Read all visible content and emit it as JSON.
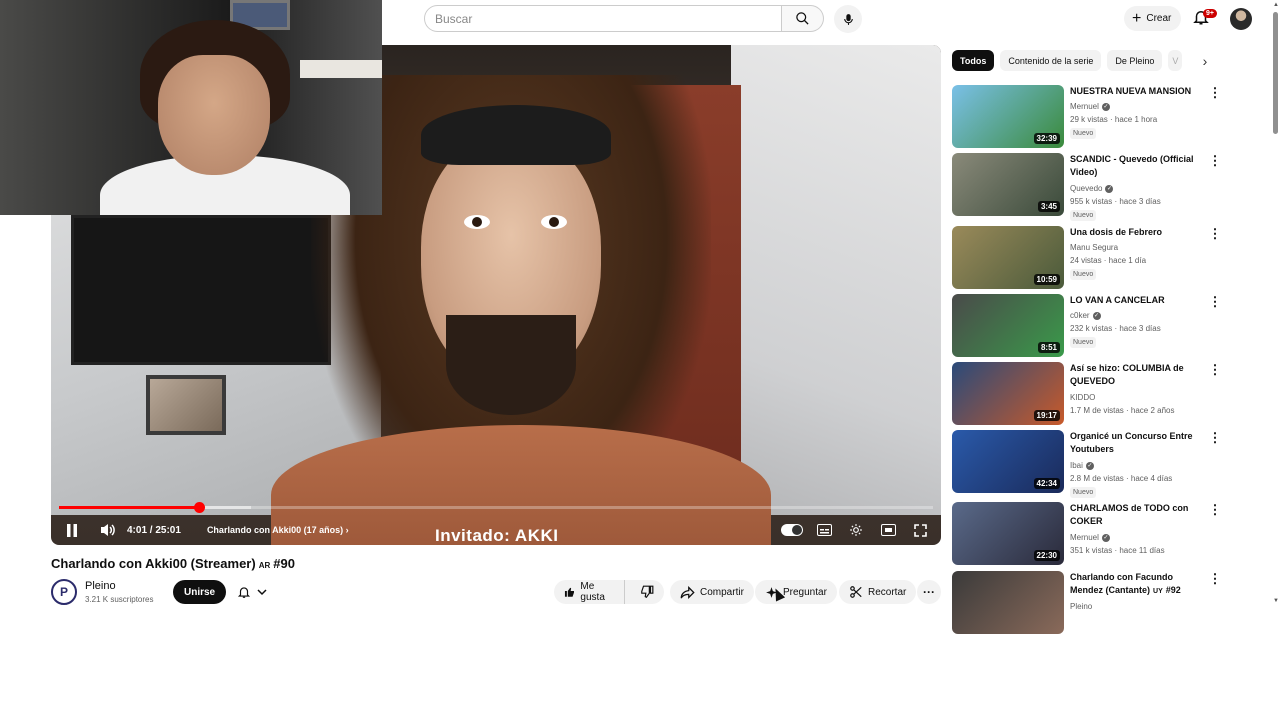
{
  "search": {
    "placeholder": "Buscar"
  },
  "header": {
    "create_label": "Crear",
    "notifications_badge": "9+"
  },
  "player": {
    "time": "4:01 / 25:01",
    "chapter": "Charlando con Akki00 (17 años)",
    "caption": "Invitado: AKKI",
    "progress_played": 0.16,
    "progress_loaded": 0.22
  },
  "video": {
    "title": "Charlando con Akki00 (Streamer)",
    "flag": "AR",
    "episode": "#90",
    "channel": "Pleino",
    "subscribers": "3.21 K suscriptores",
    "join_label": "Unirse",
    "like_label": "Me gusta",
    "share_label": "Compartir",
    "ask_label": "Preguntar",
    "clip_label": "Recortar"
  },
  "chips": [
    "Todos",
    "Contenido de la serie",
    "De Pleino",
    "V"
  ],
  "recommendations": [
    {
      "title": "NUESTRA NUEVA MANSION",
      "channel": "Mernuel",
      "verified": true,
      "meta": "29 k vistas · hace 1 hora",
      "badge": "Nuevo",
      "duration": "32:39",
      "colors": [
        "#7ac0e8",
        "#3a8a3a"
      ]
    },
    {
      "title": "SCANDIC - Quevedo (Official Video)",
      "channel": "Quevedo",
      "verified": true,
      "meta": "955 k vistas · hace 3 días",
      "badge": "Nuevo",
      "duration": "3:45",
      "colors": [
        "#8a8a7a",
        "#3a4a3a"
      ]
    },
    {
      "title": "Una dosis de Febrero",
      "channel": "Manu Segura",
      "verified": false,
      "meta": "24 vistas · hace 1 día",
      "badge": "Nuevo",
      "duration": "10:59",
      "colors": [
        "#9a8a5a",
        "#4a5a3a"
      ]
    },
    {
      "title": "LO VAN A CANCELAR",
      "channel": "c0ker",
      "verified": true,
      "meta": "232 k vistas · hace 3 días",
      "badge": "Nuevo",
      "duration": "8:51",
      "colors": [
        "#4a4a4a",
        "#3a9a4a"
      ]
    },
    {
      "title": "Así se hizo: COLUMBIA de QUEVEDO",
      "channel": "KIDDO",
      "verified": false,
      "meta": "1.7 M de vistas · hace 2 años",
      "badge": "",
      "duration": "19:17",
      "colors": [
        "#2a4a7a",
        "#c85a2a"
      ]
    },
    {
      "title": "Organicé un Concurso Entre Youtubers",
      "channel": "Ibai",
      "verified": true,
      "meta": "2.8 M de vistas · hace 4 días",
      "badge": "Nuevo",
      "duration": "42:34",
      "colors": [
        "#2a5aaa",
        "#1a2a5a"
      ]
    },
    {
      "title": "CHARLAMOS de TODO con COKER",
      "channel": "Mernuel",
      "verified": true,
      "meta": "351 k vistas · hace 11 días",
      "badge": "",
      "duration": "22:30",
      "colors": [
        "#5a6a8a",
        "#2a2a3a"
      ]
    },
    {
      "title": "Charlando con Facundo Mendez (Cantante)",
      "title_flag": "UY",
      "title_suffix": "#92",
      "channel": "Pleino",
      "verified": false,
      "meta": "",
      "badge": "",
      "duration": "",
      "colors": [
        "#3a3a3a",
        "#8a6a5a"
      ]
    }
  ]
}
